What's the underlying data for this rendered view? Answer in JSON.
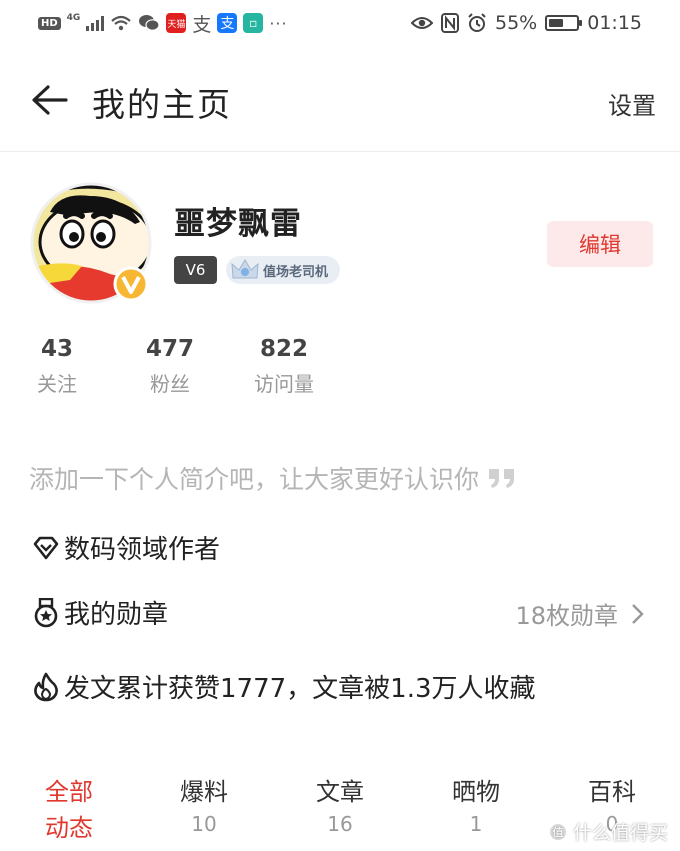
{
  "status_bar": {
    "left": {
      "hd": "HD",
      "network": "4G",
      "app_badge": "天猫",
      "alipay_text": "支",
      "alipay_badge": "支",
      "more": "···"
    },
    "battery_percent": "55%",
    "battery_level": 0.55,
    "time": "01:15"
  },
  "header": {
    "title": "我的主页",
    "settings_label": "设置"
  },
  "profile": {
    "username": "噩梦飘雷",
    "level": "V6",
    "title_badge": "值场老司机",
    "edit_label": "编辑"
  },
  "stats": [
    {
      "value": "43",
      "label": "关注"
    },
    {
      "value": "477",
      "label": "粉丝"
    },
    {
      "value": "822",
      "label": "访问量"
    }
  ],
  "bio_placeholder": "添加一下个人简介吧，让大家更好认识你",
  "author_field": "数码领域作者",
  "medals": {
    "label": "我的勋章",
    "count_text": "18枚勋章"
  },
  "achievement": "发文累计获赞1777，文章被1.3万人收藏",
  "tabs": [
    {
      "label_line1": "全部",
      "label_line2": "动态",
      "count": "",
      "active": true
    },
    {
      "label_line1": "爆料",
      "label_line2": "",
      "count": "10",
      "active": false
    },
    {
      "label_line1": "文章",
      "label_line2": "",
      "count": "16",
      "active": false
    },
    {
      "label_line1": "晒物",
      "label_line2": "",
      "count": "1",
      "active": false
    },
    {
      "label_line1": "百科",
      "label_line2": "",
      "count": "0",
      "active": false
    }
  ],
  "watermark": "什么值得买",
  "colors": {
    "accent": "#e0382f",
    "edit_bg": "#fde9e9",
    "muted": "#999999"
  }
}
